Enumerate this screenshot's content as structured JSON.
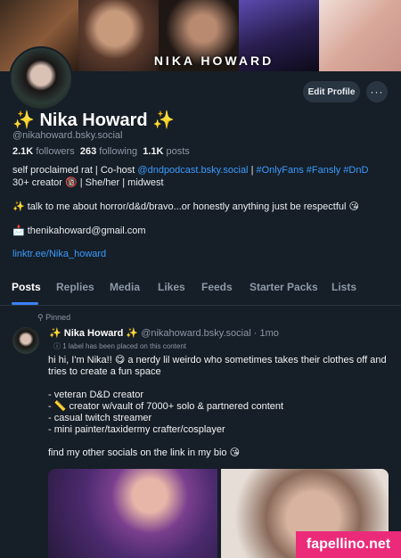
{
  "banner": {
    "name": "NIKA HOWARD"
  },
  "profile": {
    "edit_label": "Edit Profile",
    "more_label": "···",
    "display_name": "Nika Howard",
    "sparkle_left": "✨",
    "sparkle_right": "✨",
    "handle": "@nikahoward.bsky.social",
    "followers_count": "2.1K",
    "followers_label": "followers",
    "following_count": "263",
    "following_label": "following",
    "posts_count": "1.1K",
    "posts_label": "posts",
    "bio_prefix": "self proclaimed rat | Co-host ",
    "bio_link1": "@dndpodcast.bsky.social",
    "bio_sep": " | ",
    "bio_tags": "#OnlyFans #Fansly #DnD",
    "bio_line1b": "30+ creator 🔞 | She/her | midwest",
    "bio_line2": "✨ talk to me about horror/d&d/bravo...or honestly anything just be respectful 😘",
    "bio_email": "📩 thenikahoward@gmail.com",
    "bio_link2": "linktr.ee/Nika_howard"
  },
  "tabs": [
    "Posts",
    "Replies",
    "Media",
    "Likes",
    "Feeds",
    "Starter Packs",
    "Lists"
  ],
  "post": {
    "pinned_label": "Pinned",
    "author": "✨ Nika Howard ✨",
    "handle": "@nikahoward.bsky.social",
    "time": "· 1mo",
    "label_note": "1 label has been placed on this content",
    "lines": [
      "hi hi, I'm Nika!! 😋 a nerdy lil weirdo who sometimes takes their clothes off and tries to create a fun space",
      "",
      "- veteran D&D creator",
      "- 📏 creator w/vault of 7000+ solo & partnered content",
      "- casual twitch streamer",
      "- mini painter/taxidermy crafter/cosplayer",
      "",
      "find my other socials on the link in my bio 😘"
    ]
  },
  "watermark": "fapellino.net"
}
